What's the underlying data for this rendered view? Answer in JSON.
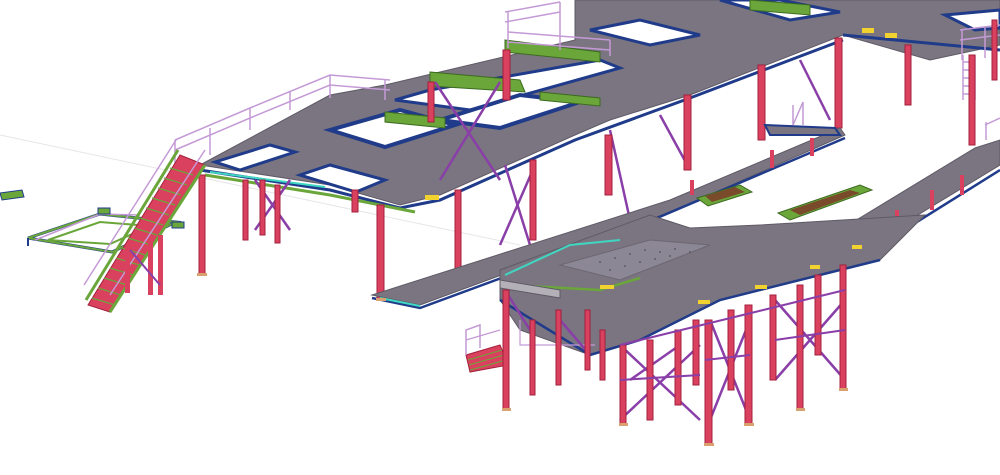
{
  "scene": {
    "subject": "",
    "colors": {
      "background": "#ffffff",
      "deck": "#7a7580",
      "deck_edge": "#5f5a66",
      "steel_column": "#d9415e",
      "primary_beam": "#1f3b8a",
      "secondary_beam": "#6aa63a",
      "bracing": "#8a3fa8",
      "handrail": "#c49ad6",
      "stair_tread": "#d9415e",
      "highlight_yellow": "#f2d22e",
      "highlight_cyan": "#3fd6c2",
      "deck_plate_texture": "#8c8794"
    }
  }
}
